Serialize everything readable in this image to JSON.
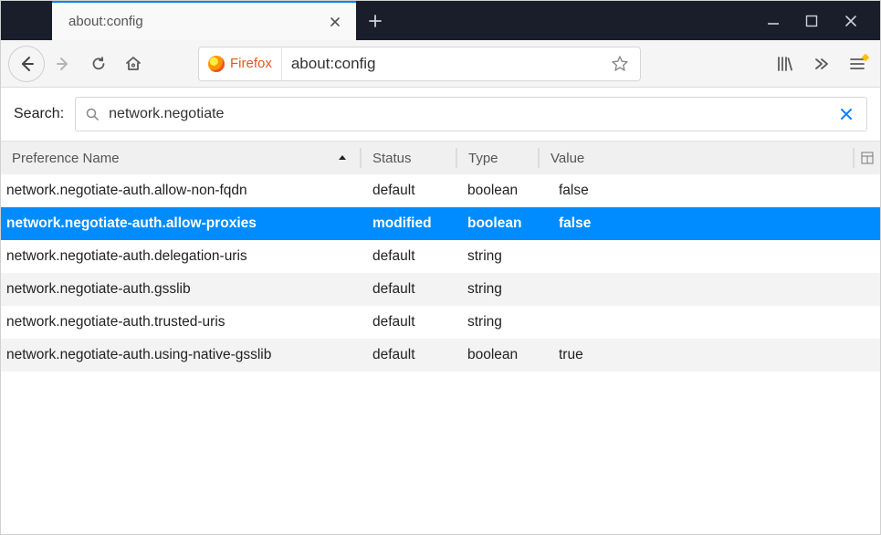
{
  "tab": {
    "title": "about:config"
  },
  "url": {
    "identity_label": "Firefox",
    "value": "about:config"
  },
  "search": {
    "label": "Search:",
    "value": "network.negotiate"
  },
  "table": {
    "headers": {
      "name": "Preference Name",
      "status": "Status",
      "type": "Type",
      "value": "Value"
    },
    "rows": [
      {
        "name": "network.negotiate-auth.allow-non-fqdn",
        "status": "default",
        "type": "boolean",
        "value": "false",
        "selected": false
      },
      {
        "name": "network.negotiate-auth.allow-proxies",
        "status": "modified",
        "type": "boolean",
        "value": "false",
        "selected": true
      },
      {
        "name": "network.negotiate-auth.delegation-uris",
        "status": "default",
        "type": "string",
        "value": "",
        "selected": false
      },
      {
        "name": "network.negotiate-auth.gsslib",
        "status": "default",
        "type": "string",
        "value": "",
        "selected": false
      },
      {
        "name": "network.negotiate-auth.trusted-uris",
        "status": "default",
        "type": "string",
        "value": "",
        "selected": false
      },
      {
        "name": "network.negotiate-auth.using-native-gsslib",
        "status": "default",
        "type": "boolean",
        "value": "true",
        "selected": false
      }
    ]
  }
}
